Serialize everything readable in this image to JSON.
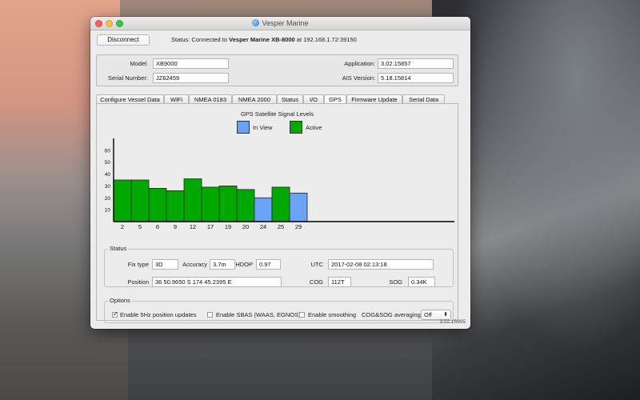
{
  "window": {
    "title": "Vesper Marine"
  },
  "topbar": {
    "disconnect_label": "Disconnect",
    "status_prefix": "Status:  Connected to ",
    "status_device": "Vesper Marine XB-8000",
    "status_suffix": " at 192.168.1.72:39150"
  },
  "device": {
    "model_label": "Model:",
    "model_value": "XB9000",
    "serial_label": "Serial Number:",
    "serial_value": "JZ62459",
    "application_label": "Application:",
    "application_value": "3.02.15857",
    "ais_label": "AIS Version:",
    "ais_value": "5.18.15814"
  },
  "tabs": [
    {
      "label": "Configure Vessel Data"
    },
    {
      "label": "WiFi"
    },
    {
      "label": "NMEA 0183"
    },
    {
      "label": "NMEA 2000"
    },
    {
      "label": "Status"
    },
    {
      "label": "I/O"
    },
    {
      "label": "GPS"
    },
    {
      "label": "Firmware Update"
    },
    {
      "label": "Serial Data"
    }
  ],
  "active_tab": "GPS",
  "gps": {
    "legend_in_view": "In View",
    "legend_active": "Active"
  },
  "colors": {
    "active": "#00a800",
    "in_view": "#6aa3f5"
  },
  "chart_data": {
    "type": "bar",
    "title": "GPS Satellite Signal Levels",
    "categories": [
      "2",
      "5",
      "6",
      "9",
      "12",
      "17",
      "19",
      "20",
      "24",
      "25",
      "29"
    ],
    "values": [
      35,
      35,
      28,
      26,
      36,
      29,
      30,
      27,
      20,
      29,
      24
    ],
    "status": [
      "Active",
      "Active",
      "Active",
      "Active",
      "Active",
      "Active",
      "Active",
      "Active",
      "In View",
      "Active",
      "In View"
    ],
    "y_ticks": [
      10,
      20,
      30,
      40,
      50,
      60
    ],
    "ylim": [
      0,
      70
    ],
    "legend": [
      "In View",
      "Active"
    ],
    "legend_position": "top-center"
  },
  "status_group": {
    "title": "Status",
    "fix_type_label": "Fix type",
    "fix_type_value": "3D",
    "accuracy_label": "Accuracy",
    "accuracy_value": "3.7m",
    "hdop_label": "HDOP",
    "hdop_value": "0.97",
    "utc_label": "UTC",
    "utc_value": "2017-02-08 02:13:18",
    "position_label": "Position",
    "position_value": "36 50.9650 S    174 45.2395 E",
    "cog_label": "COG",
    "cog_value": "112T",
    "sog_label": "SOG",
    "sog_value": "0.34K"
  },
  "options_group": {
    "title": "Options",
    "opt_5hz_label": "Enable 5Hz position updates",
    "opt_5hz_checked": true,
    "opt_sbas_label": "Enable SBAS (WAAS, EGNOS)",
    "opt_sbas_checked": false,
    "opt_smoothing_label": "Enable smoothing",
    "opt_smoothing_checked": false,
    "averaging_label": "COG&SOG averaging",
    "averaging_value": "Off"
  },
  "footer": {
    "version": "3.02.15905"
  }
}
